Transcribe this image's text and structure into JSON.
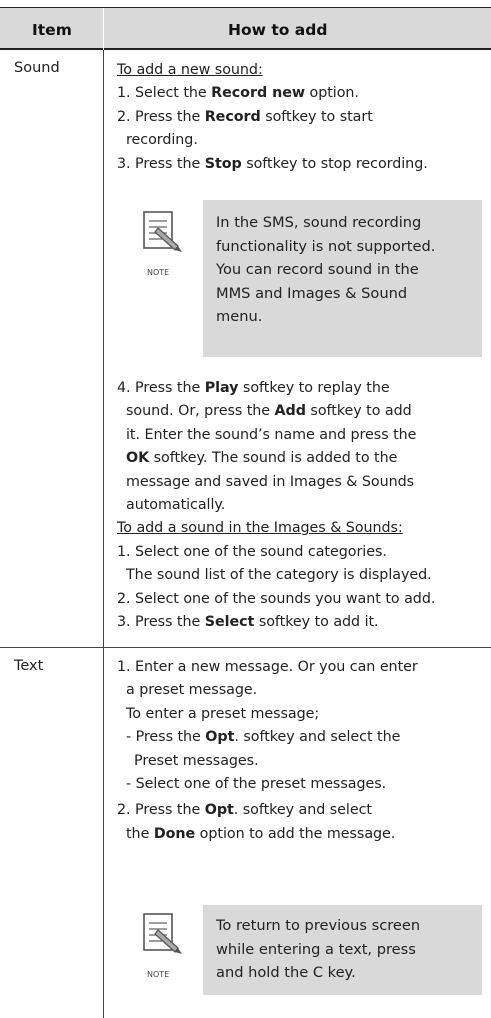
{
  "header": {
    "item": "Item",
    "how_to_add": "How to add"
  },
  "rows": [
    {
      "item": "Sound",
      "lines_a": [
        {
          "u": true,
          "parts": [
            {
              "t": "To add a new sound:"
            }
          ]
        },
        {
          "parts": [
            {
              "t": "1. Select the "
            },
            {
              "t": "Record new",
              "b": true
            },
            {
              "t": " option."
            }
          ]
        },
        {
          "parts": [
            {
              "t": "2. Press the "
            },
            {
              "t": "Record",
              "b": true
            },
            {
              "t": " softkey to start"
            }
          ]
        },
        {
          "indent": true,
          "parts": [
            {
              "t": "recording."
            }
          ]
        },
        {
          "parts": [
            {
              "t": "3. Press the "
            },
            {
              "t": "Stop",
              "b": true
            },
            {
              "t": " softkey to stop recording."
            }
          ]
        }
      ],
      "note": {
        "icon_label": "NOTE",
        "lines": [
          "In the SMS, sound recording",
          "functionality is not supported.",
          "You can record sound in the",
          "MMS and Images & Sound",
          "menu."
        ]
      },
      "lines_b": [
        {
          "parts": [
            {
              "t": "4. Press the "
            },
            {
              "t": "Play",
              "b": true
            },
            {
              "t": " softkey to replay the"
            }
          ]
        },
        {
          "indent": true,
          "parts": [
            {
              "t": "sound. Or, press the "
            },
            {
              "t": "Add",
              "b": true
            },
            {
              "t": " softkey to add"
            }
          ]
        },
        {
          "indent": true,
          "parts": [
            {
              "t": "it. Enter the sound’s name and press the"
            }
          ]
        },
        {
          "indent": true,
          "parts": [
            {
              "t": "OK",
              "b": true
            },
            {
              "t": " softkey. The sound is added to the"
            }
          ]
        },
        {
          "indent": true,
          "parts": [
            {
              "t": "message and saved in Images & Sounds"
            }
          ]
        },
        {
          "indent": true,
          "parts": [
            {
              "t": "automatically."
            }
          ]
        },
        {
          "u": true,
          "parts": [
            {
              "t": "To add a sound in the Images & Sounds:"
            }
          ]
        },
        {
          "parts": [
            {
              "t": "1. Select one of the sound categories."
            }
          ]
        },
        {
          "indent": true,
          "parts": [
            {
              "t": "The sound list of the category is displayed."
            }
          ]
        },
        {
          "parts": [
            {
              "t": "2. Select one of the sounds you want to add."
            }
          ]
        },
        {
          "parts": [
            {
              "t": "3. Press the "
            },
            {
              "t": "Select",
              "b": true
            },
            {
              "t": " softkey to add it."
            }
          ]
        }
      ]
    },
    {
      "item": "Text",
      "lines_a": [
        {
          "parts": [
            {
              "t": "1. Enter a new message. Or you can enter"
            }
          ]
        },
        {
          "indent": true,
          "parts": [
            {
              "t": "a preset message."
            }
          ]
        },
        {
          "indent": true,
          "parts": [
            {
              "t": "To enter a preset message;"
            }
          ]
        },
        {
          "indent": true,
          "parts": [
            {
              "t": "- Press the "
            },
            {
              "t": "Opt",
              "b": true
            },
            {
              "t": ". softkey and select the"
            }
          ]
        },
        {
          "indent2": true,
          "parts": [
            {
              "t": "Preset messages."
            }
          ]
        },
        {
          "indent": true,
          "parts": [
            {
              "t": "- Select one of the preset messages."
            }
          ]
        },
        {
          "parts": [
            {
              "t": "2. Press the "
            },
            {
              "t": "Opt",
              "b": true
            },
            {
              "t": ". softkey and select"
            }
          ]
        },
        {
          "indent": true,
          "parts": [
            {
              "t": "the "
            },
            {
              "t": "Done",
              "b": true
            },
            {
              "t": " option to add the message."
            }
          ]
        }
      ],
      "note": {
        "icon_label": "NOTE",
        "lines": [
          "To return to previous screen",
          "while entering a text, press",
          "and hold the C key."
        ]
      }
    }
  ]
}
